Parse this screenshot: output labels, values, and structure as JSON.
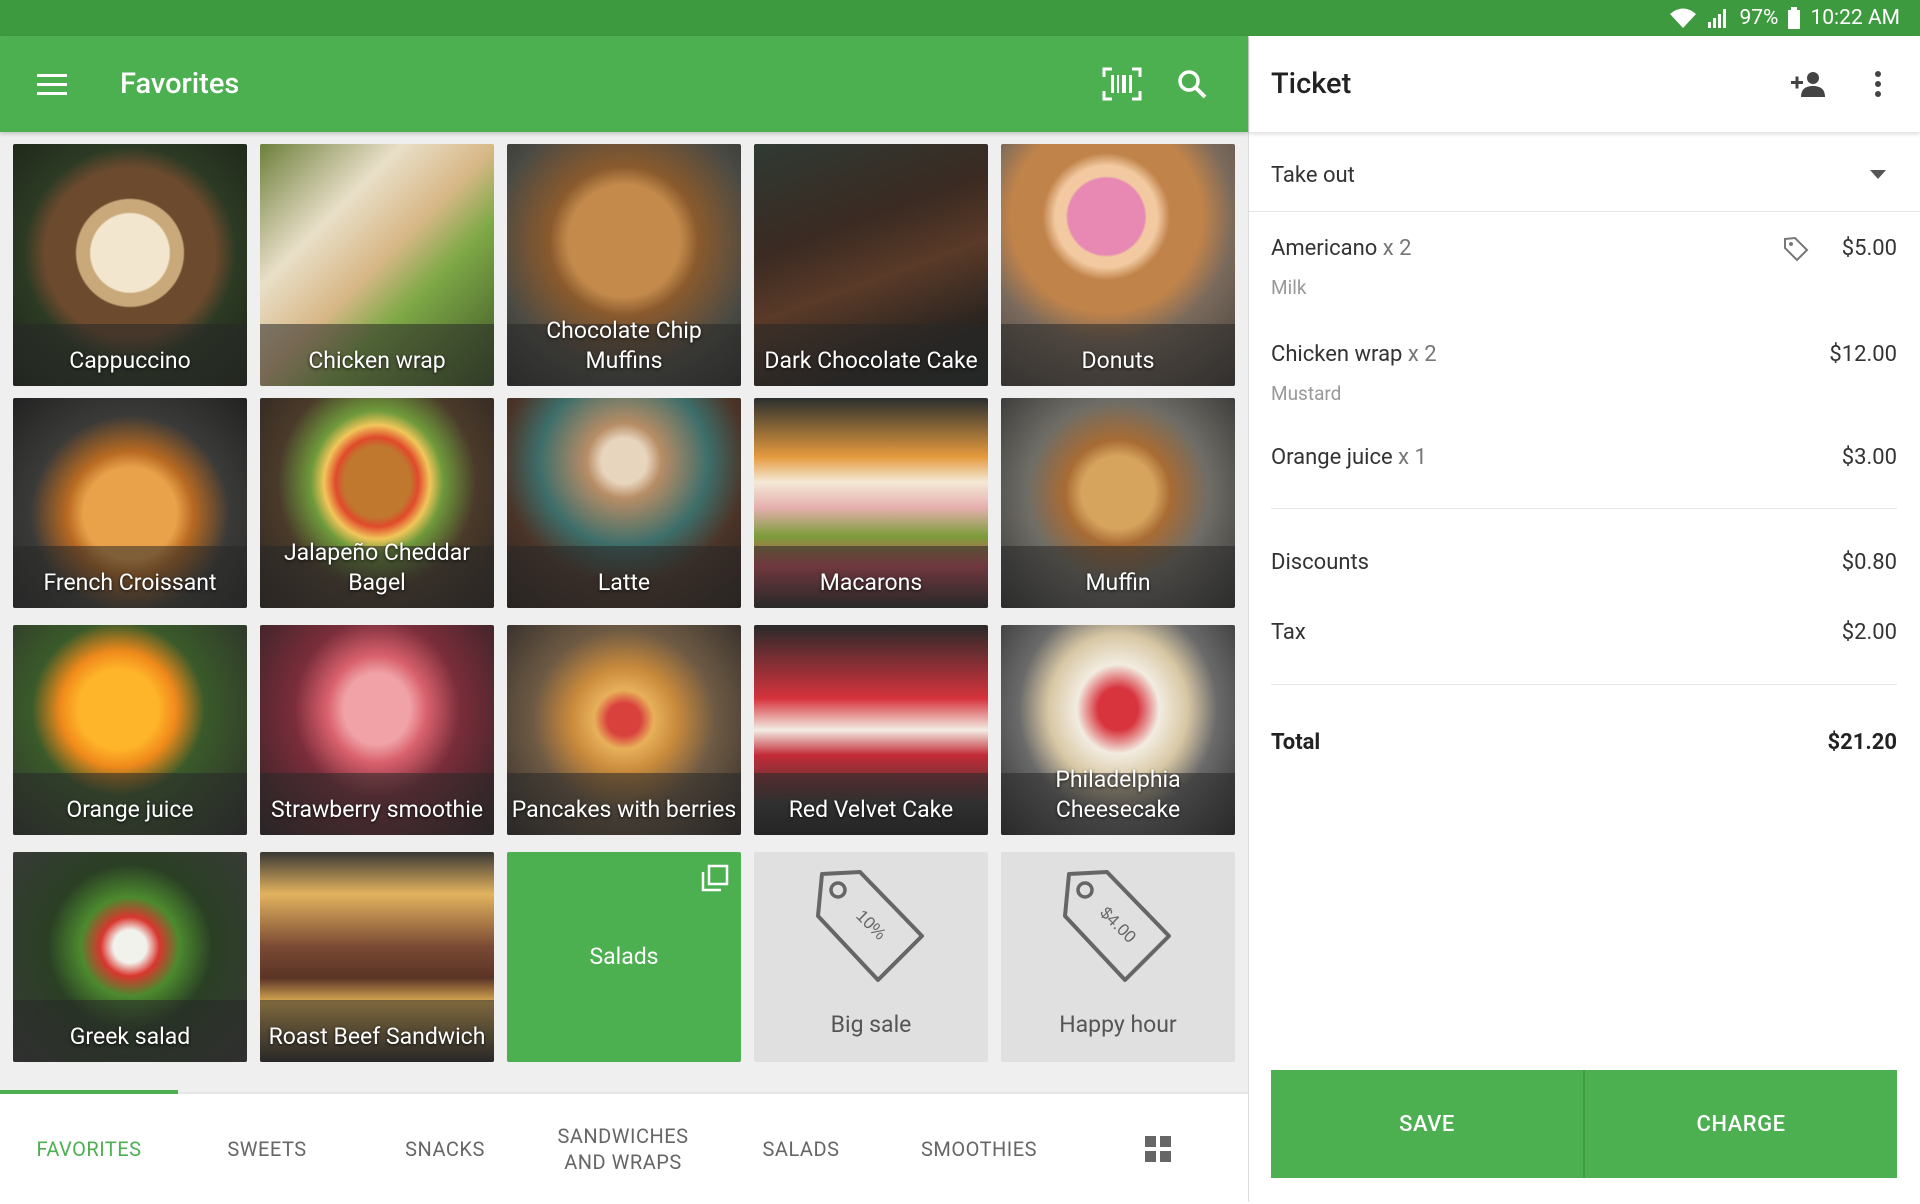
{
  "status_bar": {
    "battery": "97%",
    "time": "10:22 AM"
  },
  "header": {
    "title": "Favorites"
  },
  "items": [
    "Cappuccino",
    "Chicken wrap",
    "Chocolate Chip Muffins",
    "Dark Chocolate Cake",
    "Donuts",
    "French Croissant",
    "Jalapeño Cheddar Bagel",
    "Latte",
    "Macarons",
    "Muffin",
    "Orange juice",
    "Strawberry smoothie",
    "Pancakes with berries",
    "Red Velvet Cake",
    "Philadelphia Cheesecake",
    "Greek salad",
    "Roast Beef Sandwich",
    "Salads",
    "Big sale",
    "Happy hour"
  ],
  "discount_tags": {
    "big_sale": "10%",
    "happy_hour": "$4.00"
  },
  "tabs": [
    "FAVORITES",
    "SWEETS",
    "SNACKS",
    "SANDWICHES AND WRAPS",
    "SALADS",
    "SMOOTHIES"
  ],
  "ticket": {
    "title": "Ticket",
    "dining_option": "Take out",
    "lines": [
      {
        "name": "Americano",
        "qty": "x 2",
        "modifier": "Milk",
        "price": "$5.00"
      },
      {
        "name": "Chicken wrap",
        "qty": "x 2",
        "modifier": "Mustard",
        "price": "$12.00"
      },
      {
        "name": "Orange juice ",
        "qty": "x 1",
        "modifier": "",
        "price": "$3.00"
      }
    ],
    "discounts_label": "Discounts",
    "discounts": "$0.80",
    "tax_label": "Tax",
    "tax": "$2.00",
    "total_label": "Total",
    "total": "$21.20",
    "save_label": "SAVE",
    "charge_label": "CHARGE"
  },
  "colors": {
    "primary": "#4caf50",
    "status_bar": "#3e9a3f",
    "grid_background": "#efefef",
    "discount_tile": "#e0e0e0"
  },
  "icons": [
    "wifi-icon",
    "signal-icon",
    "battery-icon",
    "menu-icon",
    "barcode-scan-icon",
    "search-icon",
    "add-customer-icon",
    "more-vert-icon",
    "dropdown-caret-icon",
    "discount-tag-icon",
    "stack-copy-icon",
    "grid-view-icon"
  ]
}
